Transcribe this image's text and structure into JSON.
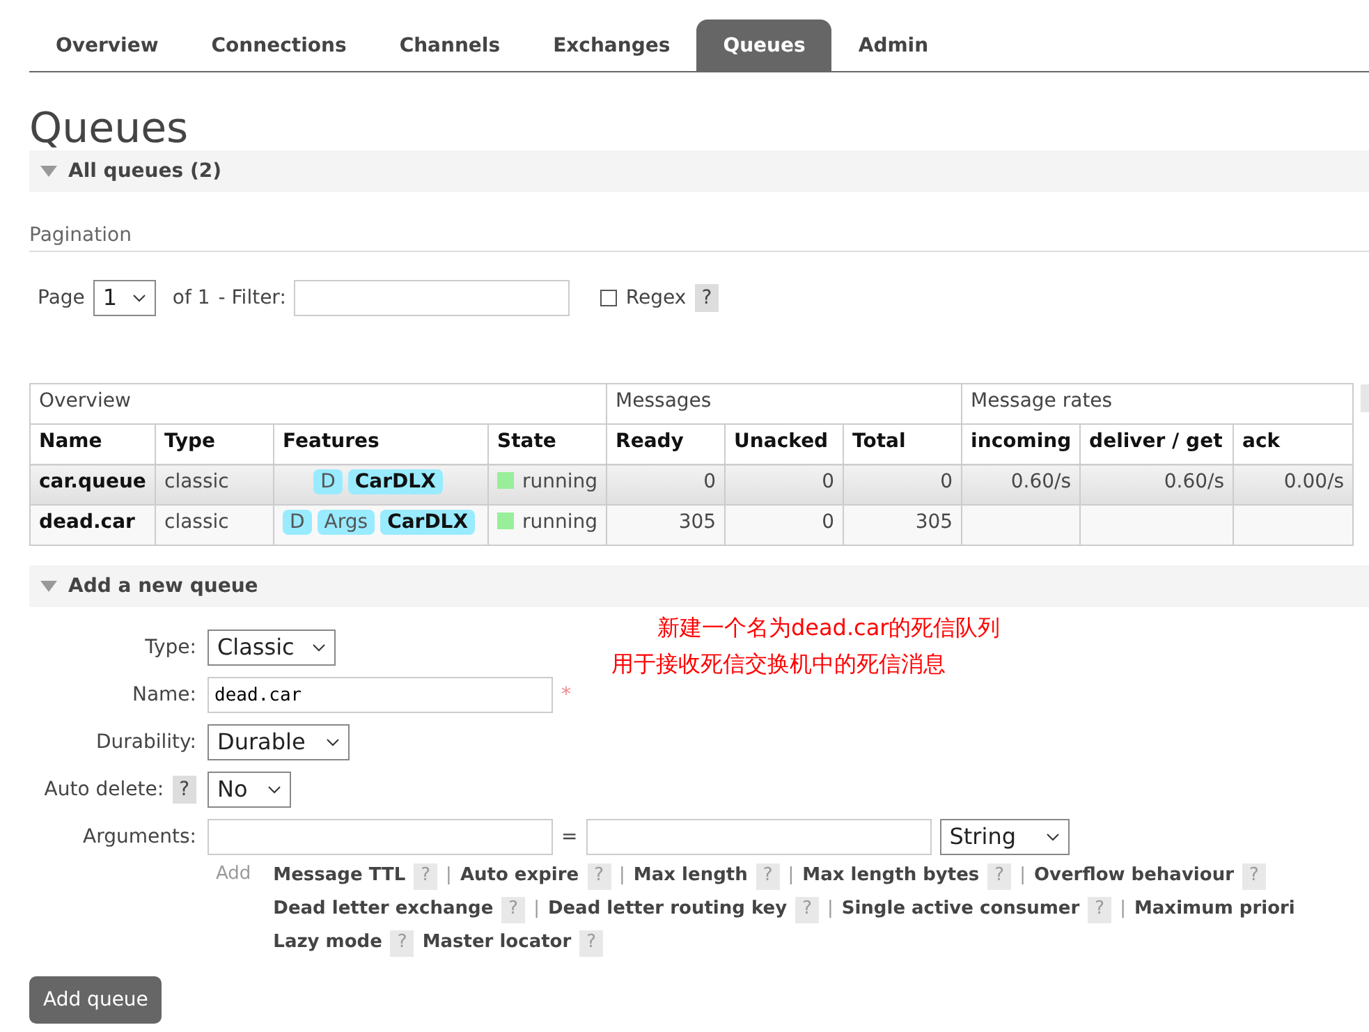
{
  "nav_tabs": [
    {
      "label": "Overview",
      "selected": false
    },
    {
      "label": "Connections",
      "selected": false
    },
    {
      "label": "Channels",
      "selected": false
    },
    {
      "label": "Exchanges",
      "selected": false
    },
    {
      "label": "Queues",
      "selected": true
    },
    {
      "label": "Admin",
      "selected": false
    }
  ],
  "title": "Queues",
  "all_queues": {
    "label": "All queues (2)",
    "expanded": true
  },
  "pagination": {
    "heading": "Pagination",
    "page_label": "Page",
    "page_value": "1",
    "of_label": "of 1",
    "filter_label": "- Filter:",
    "regex_label": "Regex",
    "regex_checked": false,
    "help": "?"
  },
  "table": {
    "groups": [
      "Overview",
      "Messages",
      "Message rates"
    ],
    "columns": [
      "Name",
      "Type",
      "Features",
      "State",
      "Ready",
      "Unacked",
      "Total",
      "incoming",
      "deliver / get",
      "ack"
    ],
    "rows": [
      {
        "selected": true,
        "name": "car.queue",
        "type": "classic",
        "features": [
          {
            "label": "D",
            "kind": "flag"
          },
          {
            "label": "CarDLX",
            "kind": "policy"
          }
        ],
        "state": "running",
        "ready": "0",
        "unacked": "0",
        "total": "0",
        "incoming": "0.60/s",
        "deliver_get": "0.60/s",
        "ack": "0.00/s"
      },
      {
        "selected": false,
        "name": "dead.car",
        "type": "classic",
        "features": [
          {
            "label": "D",
            "kind": "flag"
          },
          {
            "label": "Args",
            "kind": "flag"
          },
          {
            "label": "CarDLX",
            "kind": "policy"
          }
        ],
        "state": "running",
        "ready": "305",
        "unacked": "0",
        "total": "305"
      }
    ]
  },
  "add_queue": {
    "label": "Add a new queue",
    "expanded": true,
    "annotation": [
      "新建一个名为dead.car的死信队列",
      "用于接收死信交换机中的死信消息"
    ],
    "fields": [
      {
        "kind": "select",
        "label": "Type:",
        "value": "Classic"
      },
      {
        "kind": "text",
        "label": "Name:",
        "value": "dead.car",
        "required": "*"
      },
      {
        "kind": "select",
        "label": "Durability:",
        "value": "Durable"
      },
      {
        "kind": "select",
        "label": "Auto delete:",
        "help": "?",
        "value": "No"
      },
      {
        "kind": "arguments",
        "label": "Arguments:",
        "equals": "=",
        "type_value": "String"
      }
    ],
    "add_label": "Add",
    "arg_rows": [
      [
        {
          "label": "Message TTL",
          "help": "?",
          "separator": "|"
        },
        {
          "label": "Auto expire",
          "help": "?",
          "separator": "|"
        },
        {
          "label": "Max length",
          "help": "?",
          "separator": "|"
        },
        {
          "label": "Max length bytes",
          "help": "?",
          "separator": "|"
        },
        {
          "label": "Overflow behaviour",
          "help": "?"
        }
      ],
      [
        {
          "label": "Dead letter exchange",
          "help": "?",
          "separator": "|"
        },
        {
          "label": "Dead letter routing key",
          "help": "?",
          "separator": "|"
        },
        {
          "label": "Single active consumer",
          "help": "?",
          "separator": "|"
        },
        {
          "label": "Maximum priori"
        }
      ],
      [
        {
          "label": "Lazy mode",
          "help": "?"
        },
        {
          "label": "Master locator",
          "help": "?"
        }
      ]
    ],
    "submit": "Add queue"
  }
}
